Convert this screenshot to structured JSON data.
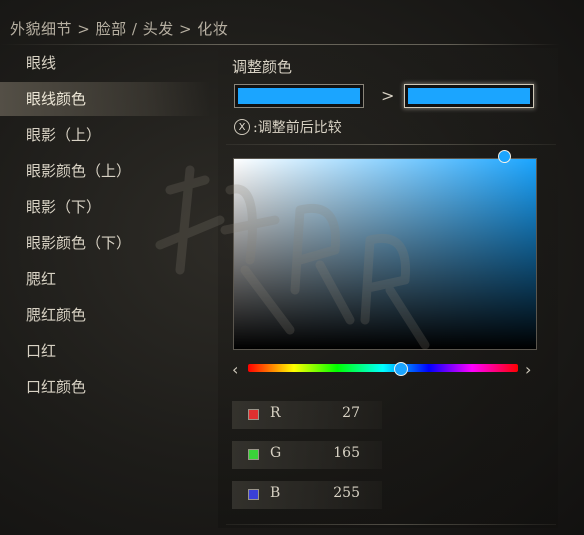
{
  "breadcrumb": "外貌细节 > 脸部 / 头发 > 化妆",
  "sidebar": {
    "items": [
      {
        "label": "眼线"
      },
      {
        "label": "眼线颜色",
        "selected": true
      },
      {
        "label": "眼影（上）"
      },
      {
        "label": "眼影颜色（上）"
      },
      {
        "label": "眼影（下）"
      },
      {
        "label": "眼影颜色（下）"
      },
      {
        "label": "腮红"
      },
      {
        "label": "腮红颜色"
      },
      {
        "label": "口红"
      },
      {
        "label": "口红颜色"
      }
    ]
  },
  "panel": {
    "title": "调整颜色",
    "before_color": "#1BA5FF",
    "after_color": "#1BA5FF",
    "arrow": ">",
    "compare_key": "X",
    "compare_label": ":调整前后比较"
  },
  "picker": {
    "hue_color": "#1BA5FF",
    "arrow_left": "‹",
    "arrow_right": "›"
  },
  "rgb": [
    {
      "label": "R",
      "value": "27",
      "color": "#e03030"
    },
    {
      "label": "G",
      "value": "165",
      "color": "#3ad23a"
    },
    {
      "label": "B",
      "value": "255",
      "color": "#3a40d8"
    }
  ]
}
